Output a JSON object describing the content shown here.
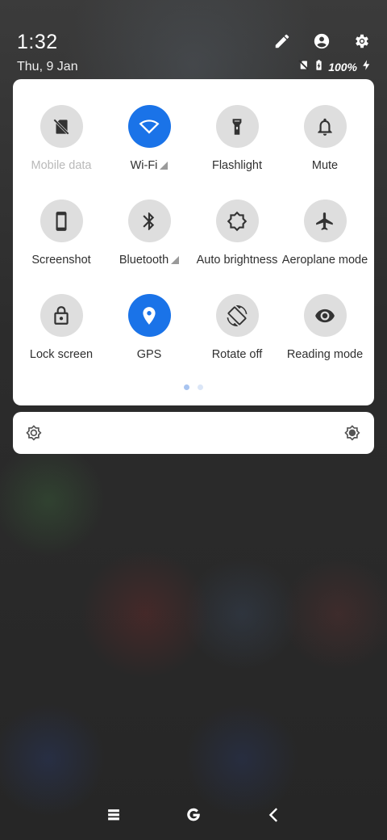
{
  "status": {
    "time": "1:32",
    "date": "Thu, 9 Jan",
    "battery": "100%",
    "icons": [
      "edit-icon",
      "account-icon",
      "settings-icon",
      "no-sim-icon",
      "battery-charging-icon",
      "charging-bolt-icon"
    ]
  },
  "tiles": [
    {
      "label": "Mobile data",
      "icon": "no-sim-icon",
      "active": false,
      "disabled": true
    },
    {
      "label": "Wi-Fi",
      "icon": "wifi-icon",
      "active": true,
      "expand": true
    },
    {
      "label": "Flashlight",
      "icon": "flashlight-icon",
      "active": false
    },
    {
      "label": "Mute",
      "icon": "bell-icon",
      "active": false
    },
    {
      "label": "Screenshot",
      "icon": "phone-icon",
      "active": false
    },
    {
      "label": "Bluetooth",
      "icon": "bluetooth-icon",
      "active": false,
      "expand": true
    },
    {
      "label": "Auto brightness",
      "icon": "auto-brightness-icon",
      "active": false
    },
    {
      "label": "Aeroplane mode",
      "icon": "airplane-icon",
      "active": false
    },
    {
      "label": "Lock screen",
      "icon": "lock-icon",
      "active": false
    },
    {
      "label": "GPS",
      "icon": "location-icon",
      "active": true
    },
    {
      "label": "Rotate off",
      "icon": "rotate-icon",
      "active": false
    },
    {
      "label": "Reading mode",
      "icon": "eye-icon",
      "active": false
    }
  ],
  "pager": {
    "pages": 2,
    "current": 1
  },
  "brightness": {
    "min_icon": "brightness-low-icon",
    "max_icon": "brightness-high-icon"
  },
  "navbar": {
    "buttons": [
      "recents-icon",
      "home-icon",
      "back-icon"
    ]
  },
  "colors": {
    "accent": "#1a73e8",
    "tile_off": "#dedede",
    "panel": "#ffffff"
  }
}
